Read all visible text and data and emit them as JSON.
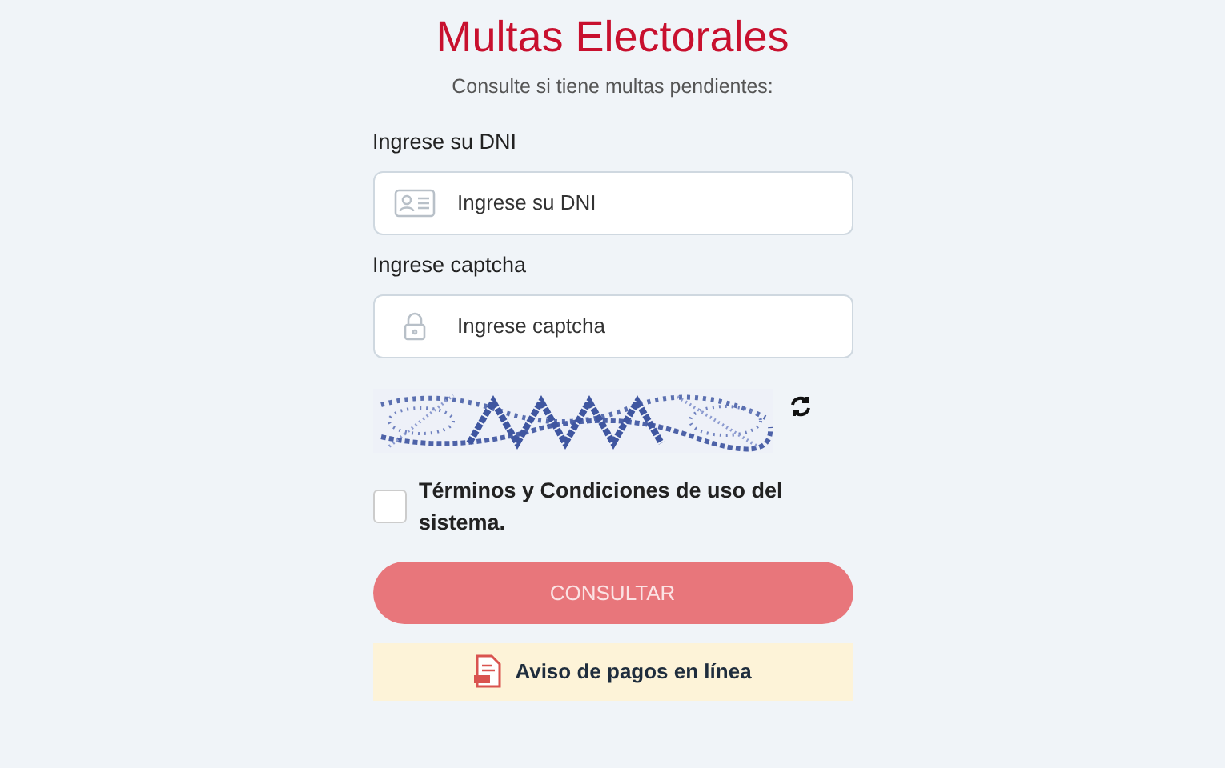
{
  "title": "Multas Electorales",
  "subtitle": "Consulte si tiene multas pendientes:",
  "fields": [
    {
      "label": "Ingrese su DNI",
      "placeholder": "Ingrese su DNI",
      "kind": "id"
    },
    {
      "label": "Ingrese captcha",
      "placeholder": "Ingrese captcha",
      "kind": "lock"
    }
  ],
  "terms": {
    "label": "Términos y Condiciones de uso del sistema.",
    "checked": false
  },
  "submit": {
    "label": "CONSULTAR",
    "disabled": true
  },
  "notice": {
    "label": "Aviso de pagos en línea"
  }
}
